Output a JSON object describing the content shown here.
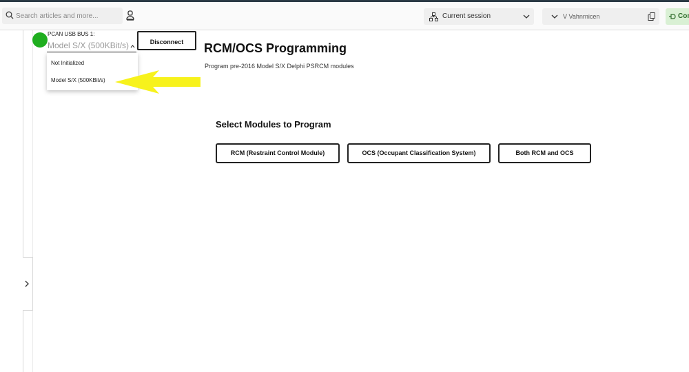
{
  "topbar": {
    "search_placeholder": "Search articles and more...",
    "session_label": "Current session",
    "vehicle_label": "V  Vahnrnicen",
    "connect_label": "Con"
  },
  "pcan": {
    "label": "PCAN USB BUS 1:",
    "selected": "Model S/X (500KBit/s)",
    "options": [
      "Not Initialized",
      "Model S/X (500KBit/s)"
    ],
    "status_color": "#1fae1f"
  },
  "buttons": {
    "disconnect": "Disconnect"
  },
  "main": {
    "title": "RCM/OCS Programming",
    "subtitle": "Program pre-2016 Model S/X Delphi PSRCM modules",
    "section_title": "Select Modules to Program",
    "modules": [
      "RCM (Restraint Control Module)",
      "OCS (Occupant Classification System)",
      "Both RCM and OCS"
    ]
  },
  "annotation": {
    "arrow_color": "#f7f21c"
  }
}
